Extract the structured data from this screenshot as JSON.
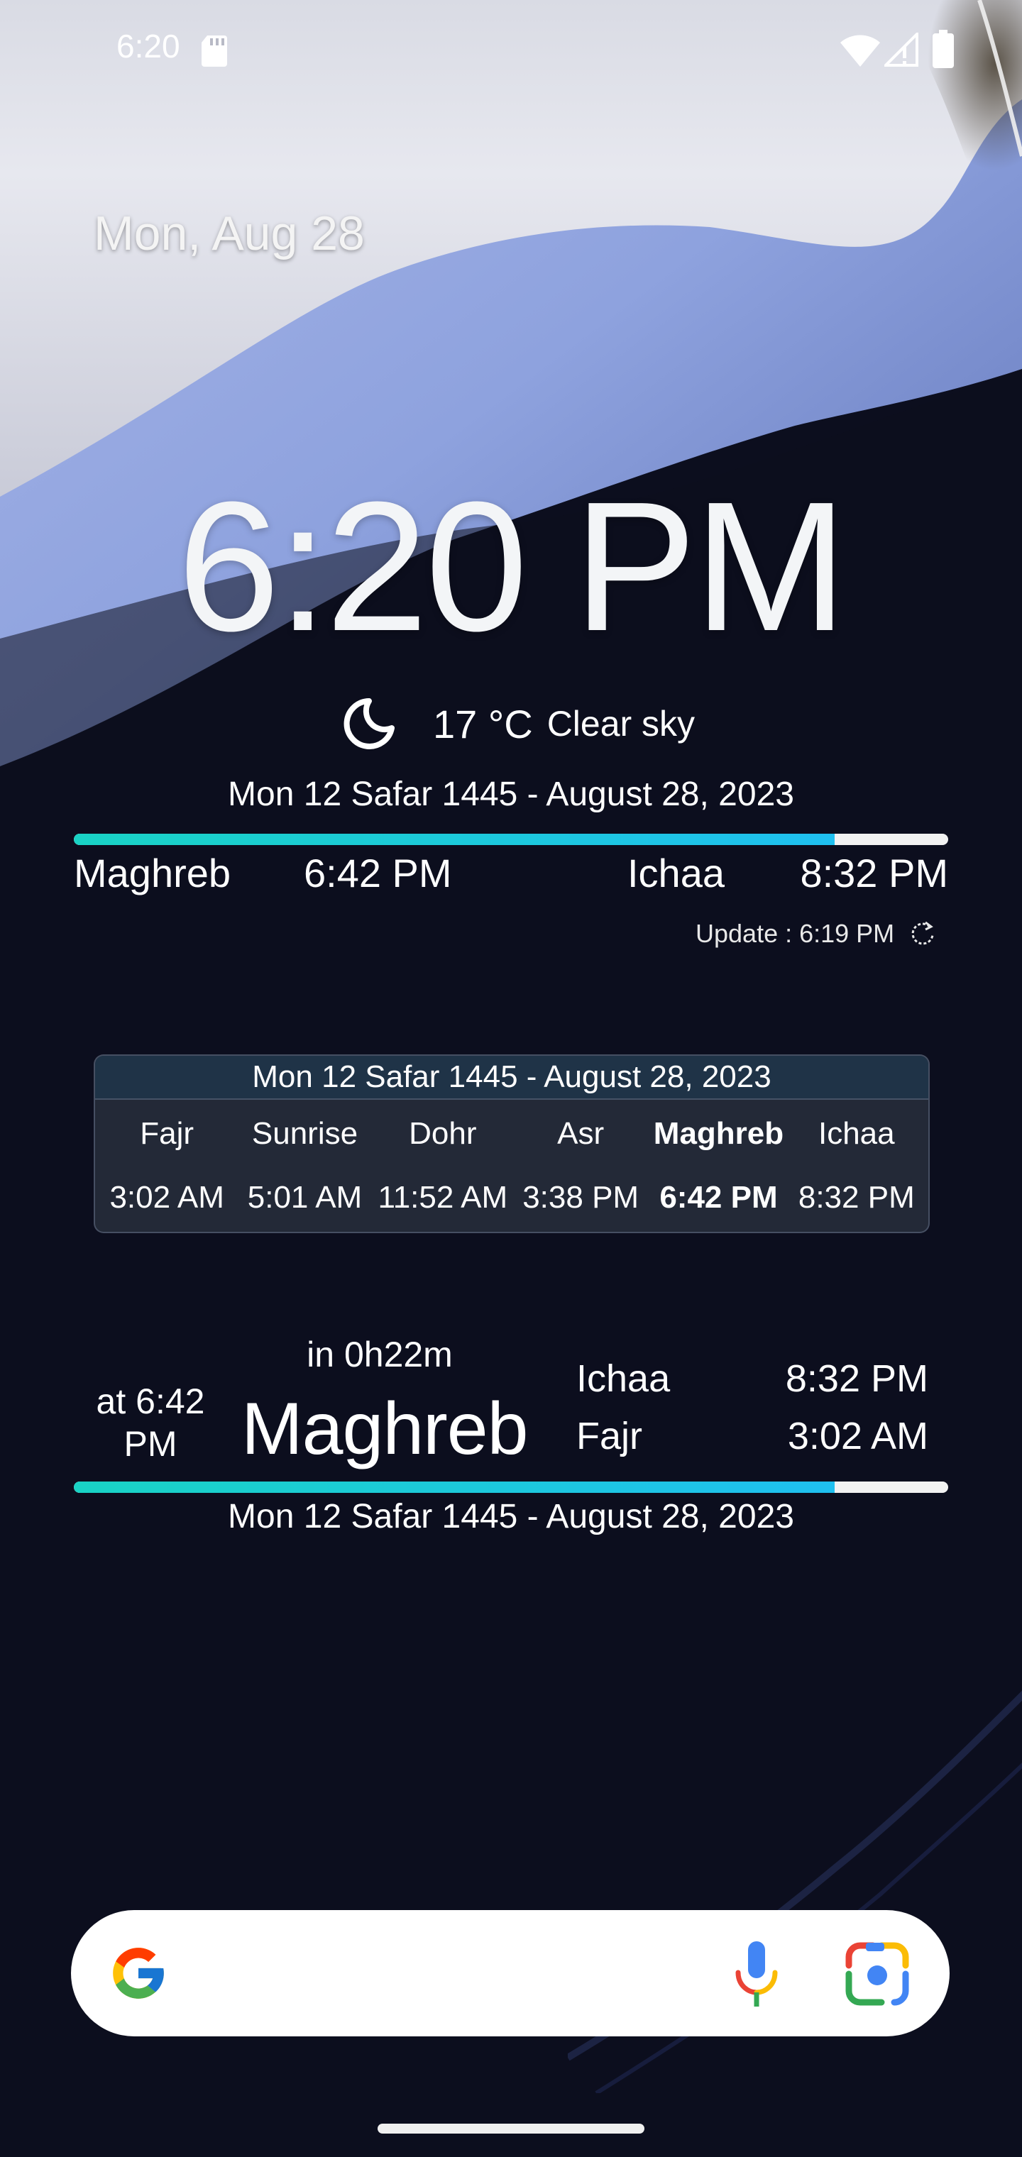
{
  "status_bar": {
    "time": "6:20"
  },
  "glance": {
    "date": "Mon, Aug 28"
  },
  "clock": {
    "time": "6:20 PM",
    "weather_temp": "17 °C",
    "weather_condition": "Clear sky",
    "hijri_date": "Mon 12 Safar 1445 - August 28, 2023",
    "progress_fraction": 0.87,
    "current_prayer": "Maghreb",
    "current_prayer_time": "6:42 PM",
    "next_prayer": "Ichaa",
    "next_prayer_time": "8:32 PM",
    "update_text": "Update : 6:19 PM"
  },
  "table_widget": {
    "header": "Mon 12 Safar 1445 - August 28, 2023",
    "prayers": [
      {
        "name": "Fajr",
        "time": "3:02 AM",
        "active": false
      },
      {
        "name": "Sunrise",
        "time": "5:01 AM",
        "active": false
      },
      {
        "name": "Dohr",
        "time": "11:52 AM",
        "active": false
      },
      {
        "name": "Asr",
        "time": "3:38 PM",
        "active": false
      },
      {
        "name": "Maghreb",
        "time": "6:42 PM",
        "active": true
      },
      {
        "name": "Ichaa",
        "time": "8:32 PM",
        "active": false
      }
    ]
  },
  "next_widget": {
    "at_line1": "at 6:42",
    "at_line2": "PM",
    "countdown": "in 0h22m",
    "prayer_name": "Maghreb",
    "upcoming": [
      {
        "name": "Ichaa",
        "time": "8:32 PM"
      },
      {
        "name": "Fajr",
        "time": "3:02 AM"
      }
    ],
    "progress_fraction": 0.87,
    "hijri_date": "Mon 12 Safar 1445 - August 28, 2023"
  },
  "search": {
    "google_icon": "google-g-icon",
    "mic_icon": "microphone-icon",
    "lens_icon": "google-lens-icon"
  },
  "colors": {
    "accent_start": "#19d3c5",
    "accent_end": "#1fc0f0",
    "background": "#0c0e1e"
  }
}
